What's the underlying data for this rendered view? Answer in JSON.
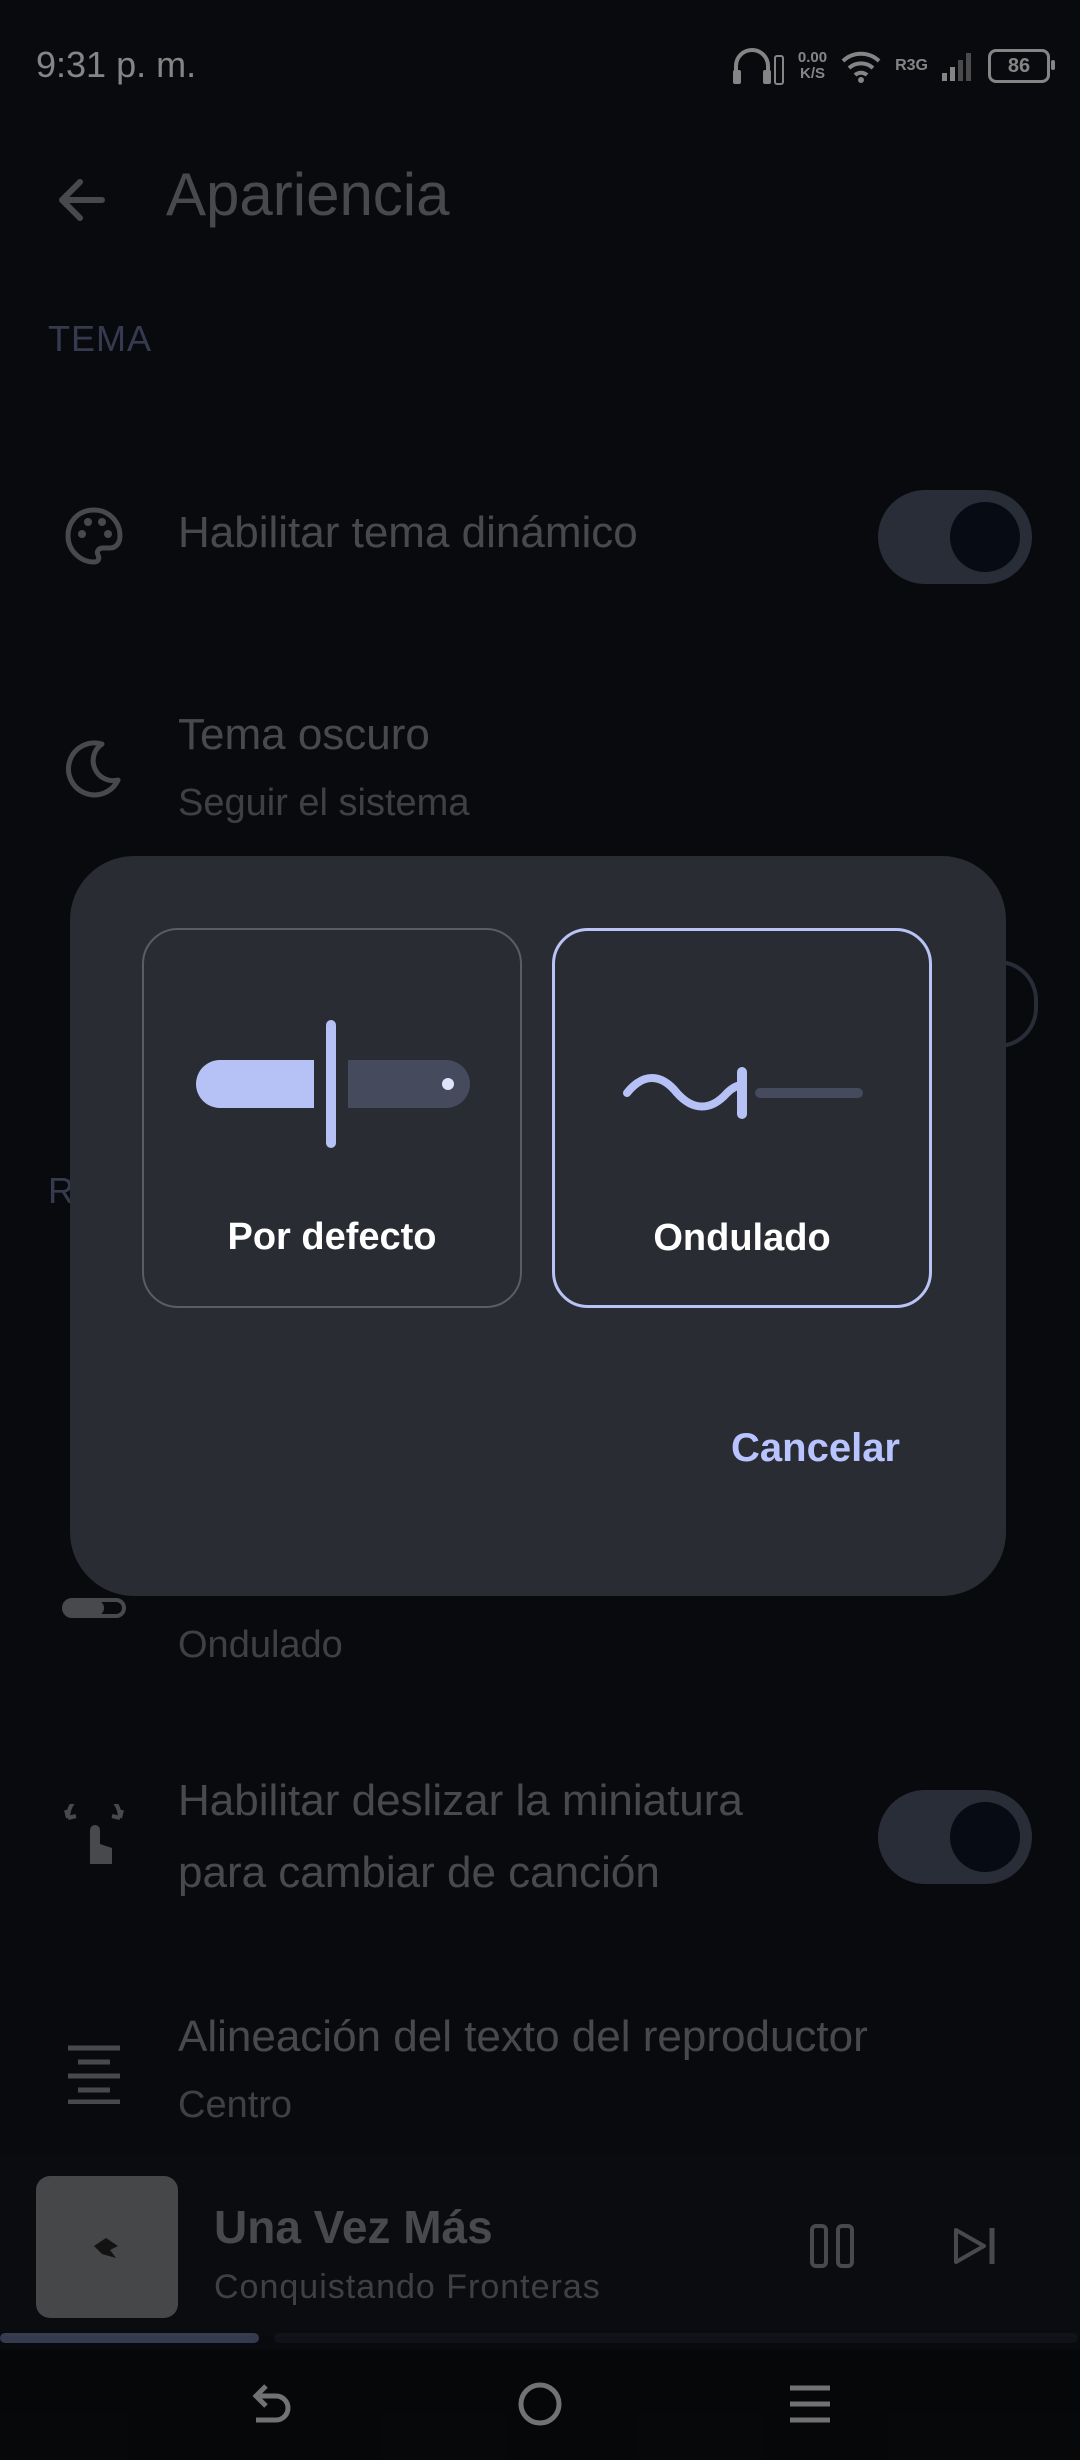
{
  "status_bar": {
    "time": "9:31 p. m.",
    "net_speed_value": "0.00",
    "net_speed_unit": "K/S",
    "signal_label": "R3G",
    "battery": "86"
  },
  "toolbar": {
    "title": "Apariencia"
  },
  "sections": {
    "tema": "TEMA",
    "reproductor_partial": "R"
  },
  "settings": {
    "dynamic_theme": {
      "title": "Habilitar tema dinámico",
      "enabled": true
    },
    "dark_theme": {
      "title": "Tema oscuro",
      "subtitle": "Seguir el sistema"
    },
    "slider_style": {
      "value": "Ondulado"
    },
    "swipe_thumbnail": {
      "title_line1": "Habilitar deslizar la miniatura",
      "title_line2": "para cambiar de canción",
      "enabled": true
    },
    "text_alignment": {
      "title": "Alineación del texto del reproductor",
      "subtitle": "Centro"
    }
  },
  "mini_player": {
    "title": "Una Vez Más",
    "artist": "Conquistando Fronteras",
    "progress": 0.24
  },
  "dialog": {
    "options": [
      {
        "label": "Por defecto",
        "selected": false
      },
      {
        "label": "Ondulado",
        "selected": true
      }
    ],
    "cancel_label": "Cancelar"
  },
  "colors": {
    "background": "#111318",
    "accent": "#a6b4f2",
    "dialog_surface": "#2a2c33"
  }
}
